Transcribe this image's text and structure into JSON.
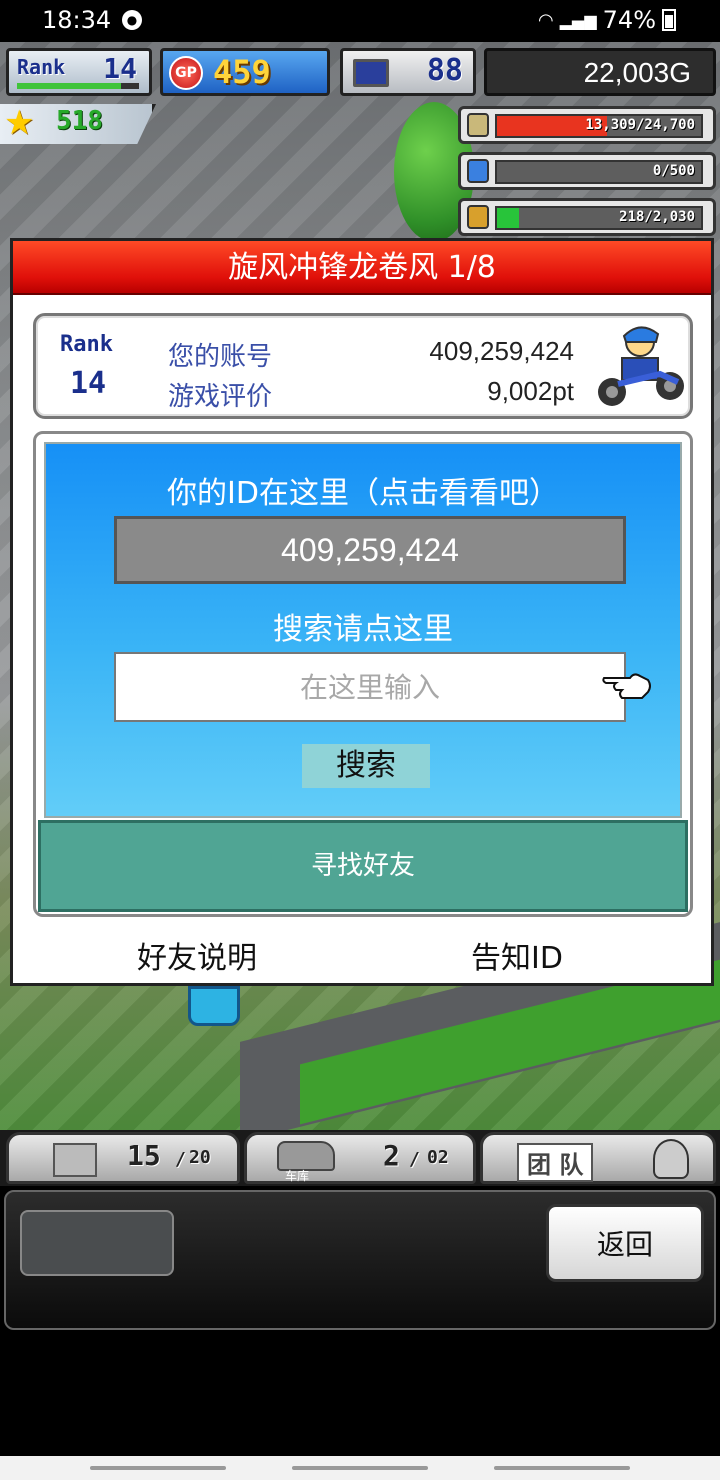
{
  "status_bar": {
    "time": "18:34",
    "battery": "74%"
  },
  "hud": {
    "rank_label": "Rank",
    "rank_value": "14",
    "gp_icon_text": "GP",
    "gp_value": "459",
    "pc_value": "88",
    "money": "22,003G",
    "stars": "518",
    "resources": [
      {
        "icon": "coins-icon",
        "text": "13,309/24,700",
        "fill": 0.54,
        "color": "#e8341f"
      },
      {
        "icon": "bottle-icon",
        "text": "0/500",
        "fill": 0.0,
        "color": "#2a70d8"
      },
      {
        "icon": "wheat-icon",
        "text": "218/2,030",
        "fill": 0.11,
        "color": "#28c43a"
      }
    ]
  },
  "dialog": {
    "title": "旋风冲锋龙卷风 1/8",
    "rank_label": "Rank",
    "rank_value": "14",
    "account_label": "您的账号",
    "account_value": "409,259,424",
    "rating_label": "游戏评价",
    "rating_value": "9,002pt",
    "id_title": "你的ID在这里（点击看看吧）",
    "id_value": "409,259,424",
    "search_title": "搜索请点这里",
    "search_placeholder": "在这里输入",
    "search_button": "搜索",
    "find_friend": "寻找好友",
    "friend_help": "好友说明",
    "notify_id": "告知ID"
  },
  "bottom_tabs": {
    "parts_count": "15",
    "parts_max": "20",
    "garage_label": "车库",
    "garage_count": "2",
    "garage_max": "02",
    "team_label": "团 队"
  },
  "bottom_panel": {
    "back_button": "返回"
  }
}
